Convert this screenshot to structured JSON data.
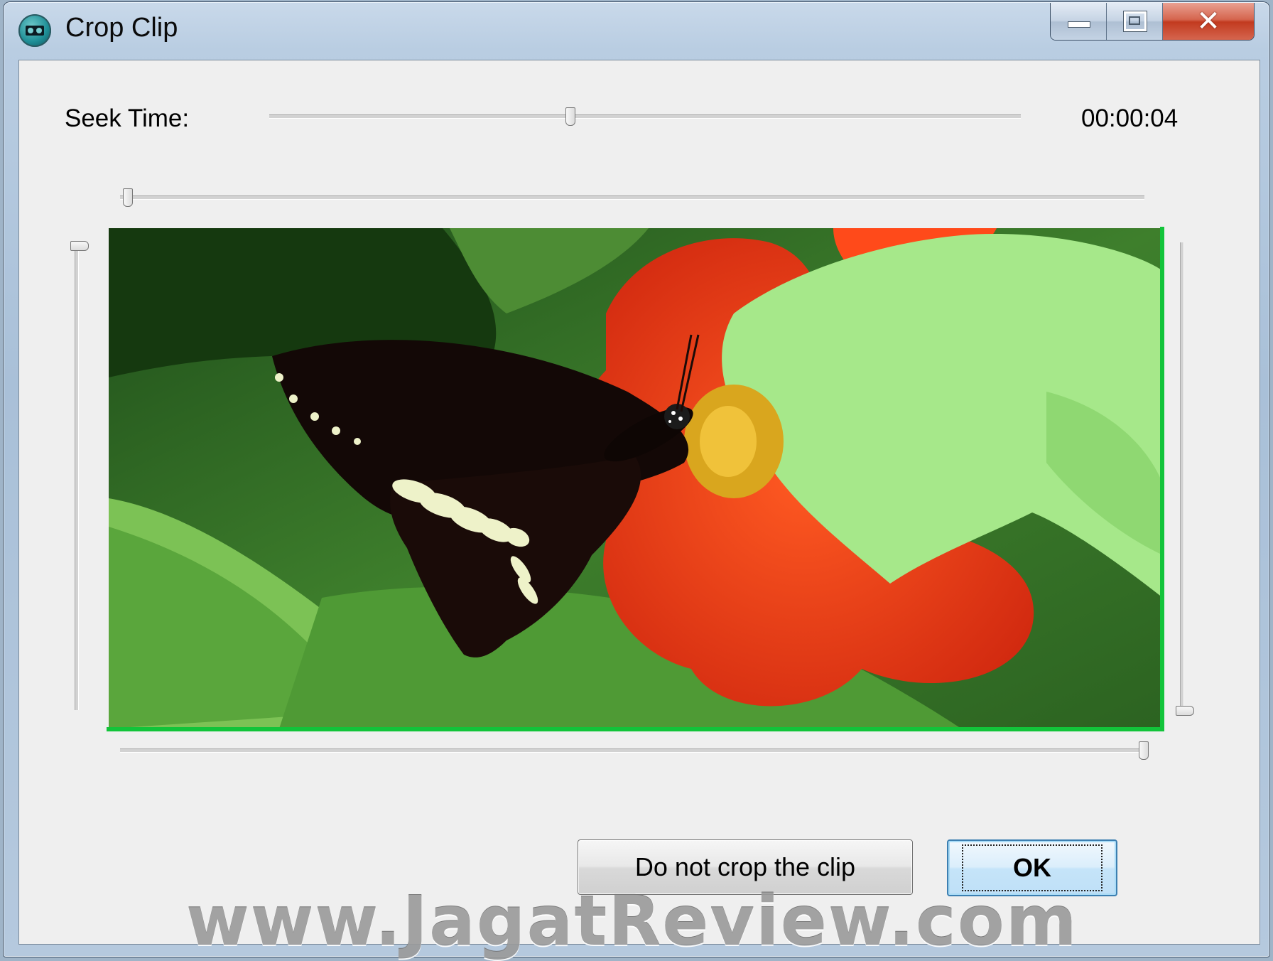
{
  "window": {
    "title": "Crop Clip",
    "icon": "film-reel-icon",
    "controls": [
      "minimize-icon",
      "maximize-icon",
      "close-icon"
    ]
  },
  "seek": {
    "label": "Seek Time:",
    "time": "00:00:04",
    "slider_position": 0.4
  },
  "crop_sliders": {
    "left_top": 0.0,
    "top_left": 0.0,
    "right_bottom": 1.0,
    "bottom_right": 1.0
  },
  "crop_color": "#12c43a",
  "buttons": {
    "no_crop": "Do not crop the clip",
    "ok": "OK"
  },
  "watermark": "www.JagatReview.com"
}
